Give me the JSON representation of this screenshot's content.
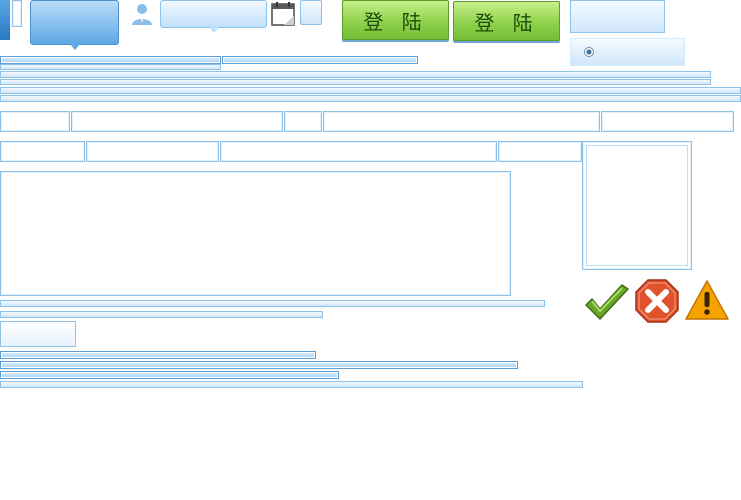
{
  "buttons": {
    "login_1": "登 陆",
    "login_2": "登 陆"
  },
  "icons": {
    "user": "user-icon",
    "calendar": "calendar-icon",
    "success": "check-icon",
    "error": "close-icon",
    "warning": "warning-icon"
  },
  "colors": {
    "accent_blue": "#5ea8e6",
    "border_blue": "#8fc2e8",
    "login_green": "#8fd14c",
    "success_green": "#6aa52d",
    "error_red": "#e0522b",
    "warning_orange": "#f6a300"
  }
}
